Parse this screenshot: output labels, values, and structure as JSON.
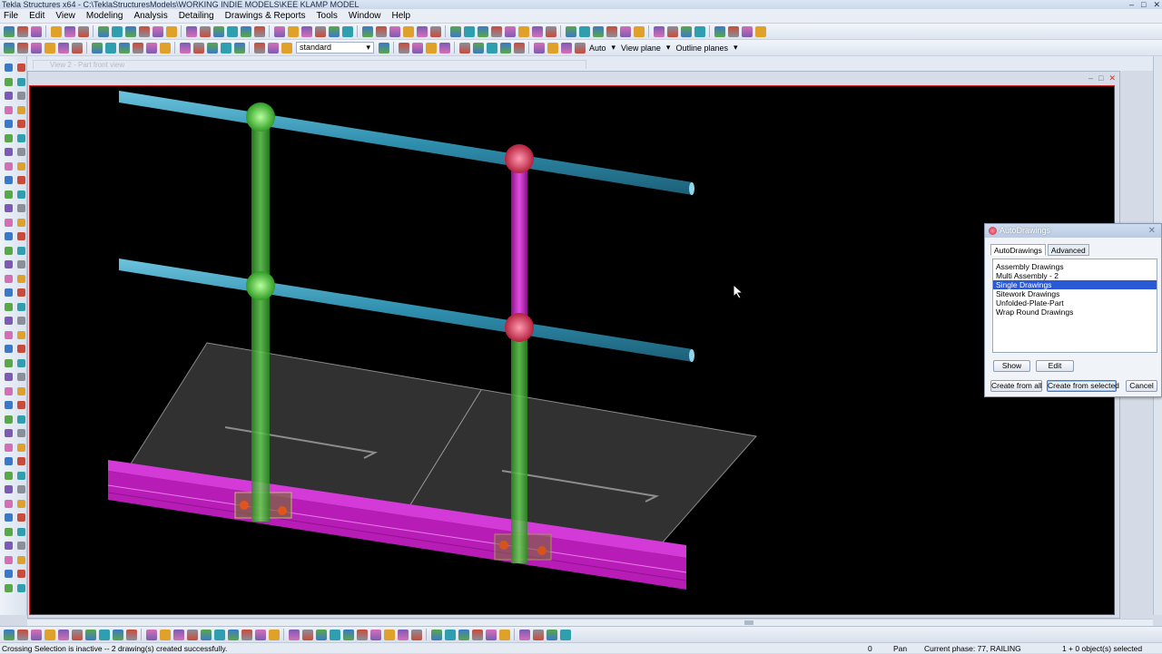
{
  "window": {
    "title": "Tekla Structures x64 - C:\\TeklaStructuresModels\\WORKING INDIE MODELS\\KEE KLAMP MODEL"
  },
  "menu": [
    "File",
    "Edit",
    "View",
    "Modeling",
    "Analysis",
    "Detailing",
    "Drawings & Reports",
    "Tools",
    "Window",
    "Help"
  ],
  "toolbar2": {
    "settings_select": "standard",
    "work_plane_mode": "Auto",
    "view_plane_label": "View plane",
    "outline_planes_label": "Outline planes"
  },
  "ghost_window_title": "View 2 - Part front view",
  "dialog": {
    "title": "AutoDrawings",
    "tabs": [
      "AutoDrawings",
      "Advanced"
    ],
    "list_items": [
      "Assembly Drawings",
      "Multi Assembly - 2",
      "Single Drawings",
      "Sitework Drawings",
      "Unfolded-Plate-Part",
      "Wrap Round Drawings"
    ],
    "selected_item": "Single Drawings",
    "show_label": "Show",
    "edit_label": "Edit",
    "create_all_label": "Create from all",
    "create_selected_label": "Create from selected",
    "cancel_label": "Cancel"
  },
  "status": {
    "message": "Crossing Selection is inactive -- 2 drawing(s) created successfully.",
    "coord": "0",
    "mode": "Pan",
    "phase": "Current phase: 77, RAILING",
    "selection": "1 + 0 object(s) selected"
  },
  "colors": {
    "rail": "#2f8fae",
    "post_green": "#3caa2e",
    "post_magenta": "#b81cb6",
    "beam": "#c21ec8",
    "viewport_border": "#cc1c1c",
    "selection": "#2a59d6"
  }
}
